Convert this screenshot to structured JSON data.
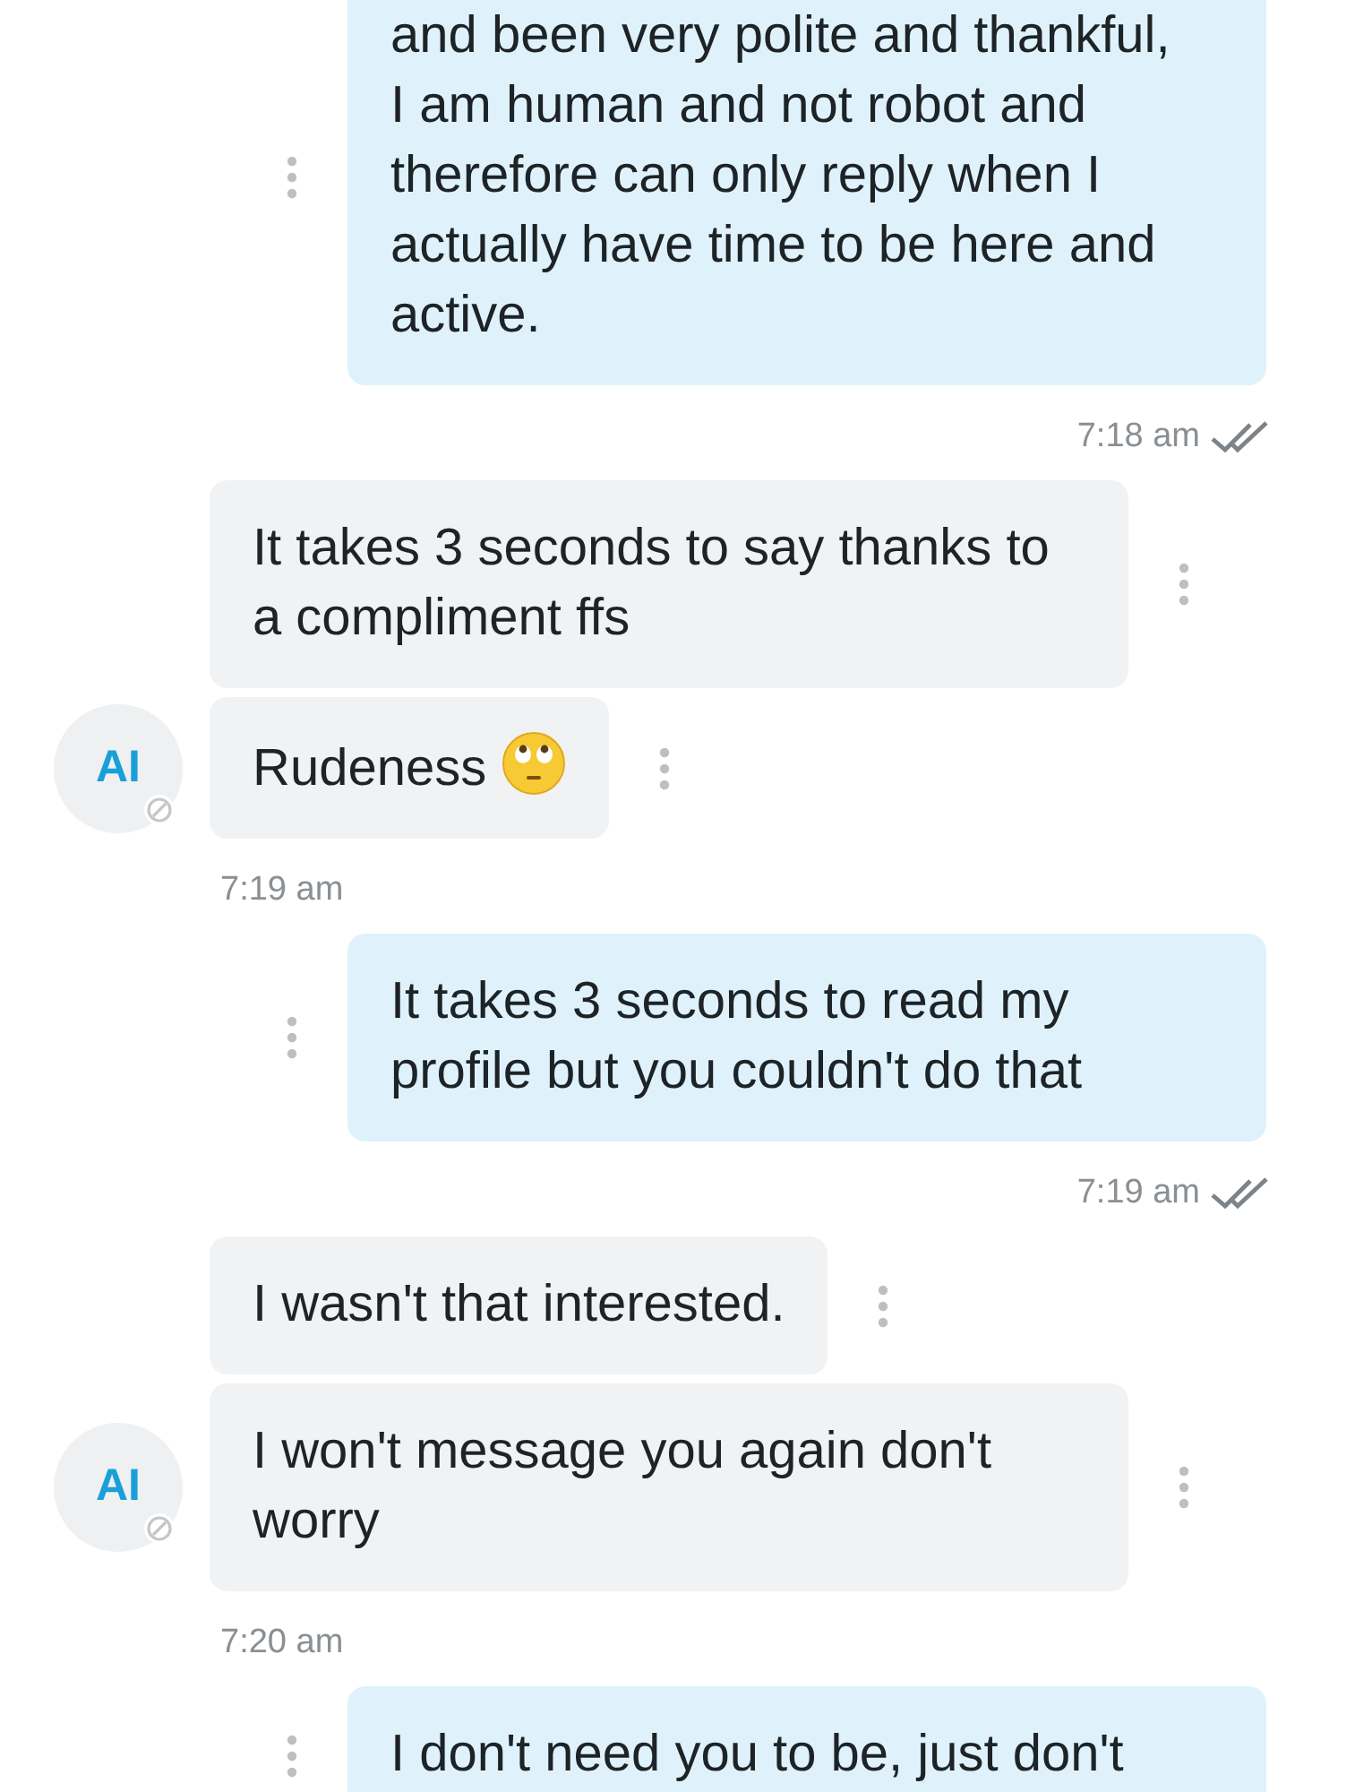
{
  "messages": [
    {
      "kind": "outgoing",
      "text": "and been very polite and thankful, I am human and not robot and therefore can only reply when I actually have time to be here and active."
    },
    {
      "kind": "sent_time",
      "text": "7:18 am",
      "read": true
    },
    {
      "kind": "incoming",
      "text": "It takes 3 seconds to say thanks to a compliment ffs"
    },
    {
      "kind": "incoming",
      "text": "Rudeness",
      "emoji": true,
      "avatar": "AI"
    },
    {
      "kind": "received_time",
      "text": "7:19 am"
    },
    {
      "kind": "outgoing",
      "text": "It takes 3 seconds to read my profile but you couldn't do that"
    },
    {
      "kind": "sent_time",
      "text": "7:19 am",
      "read": true
    },
    {
      "kind": "incoming",
      "text": "I wasn't that interested."
    },
    {
      "kind": "incoming",
      "text": "I won't message you again don't worry",
      "avatar": "AI"
    },
    {
      "kind": "received_time",
      "text": "7:20 am"
    },
    {
      "kind": "outgoing",
      "text": "I don't need you to be, just don't"
    }
  ]
}
